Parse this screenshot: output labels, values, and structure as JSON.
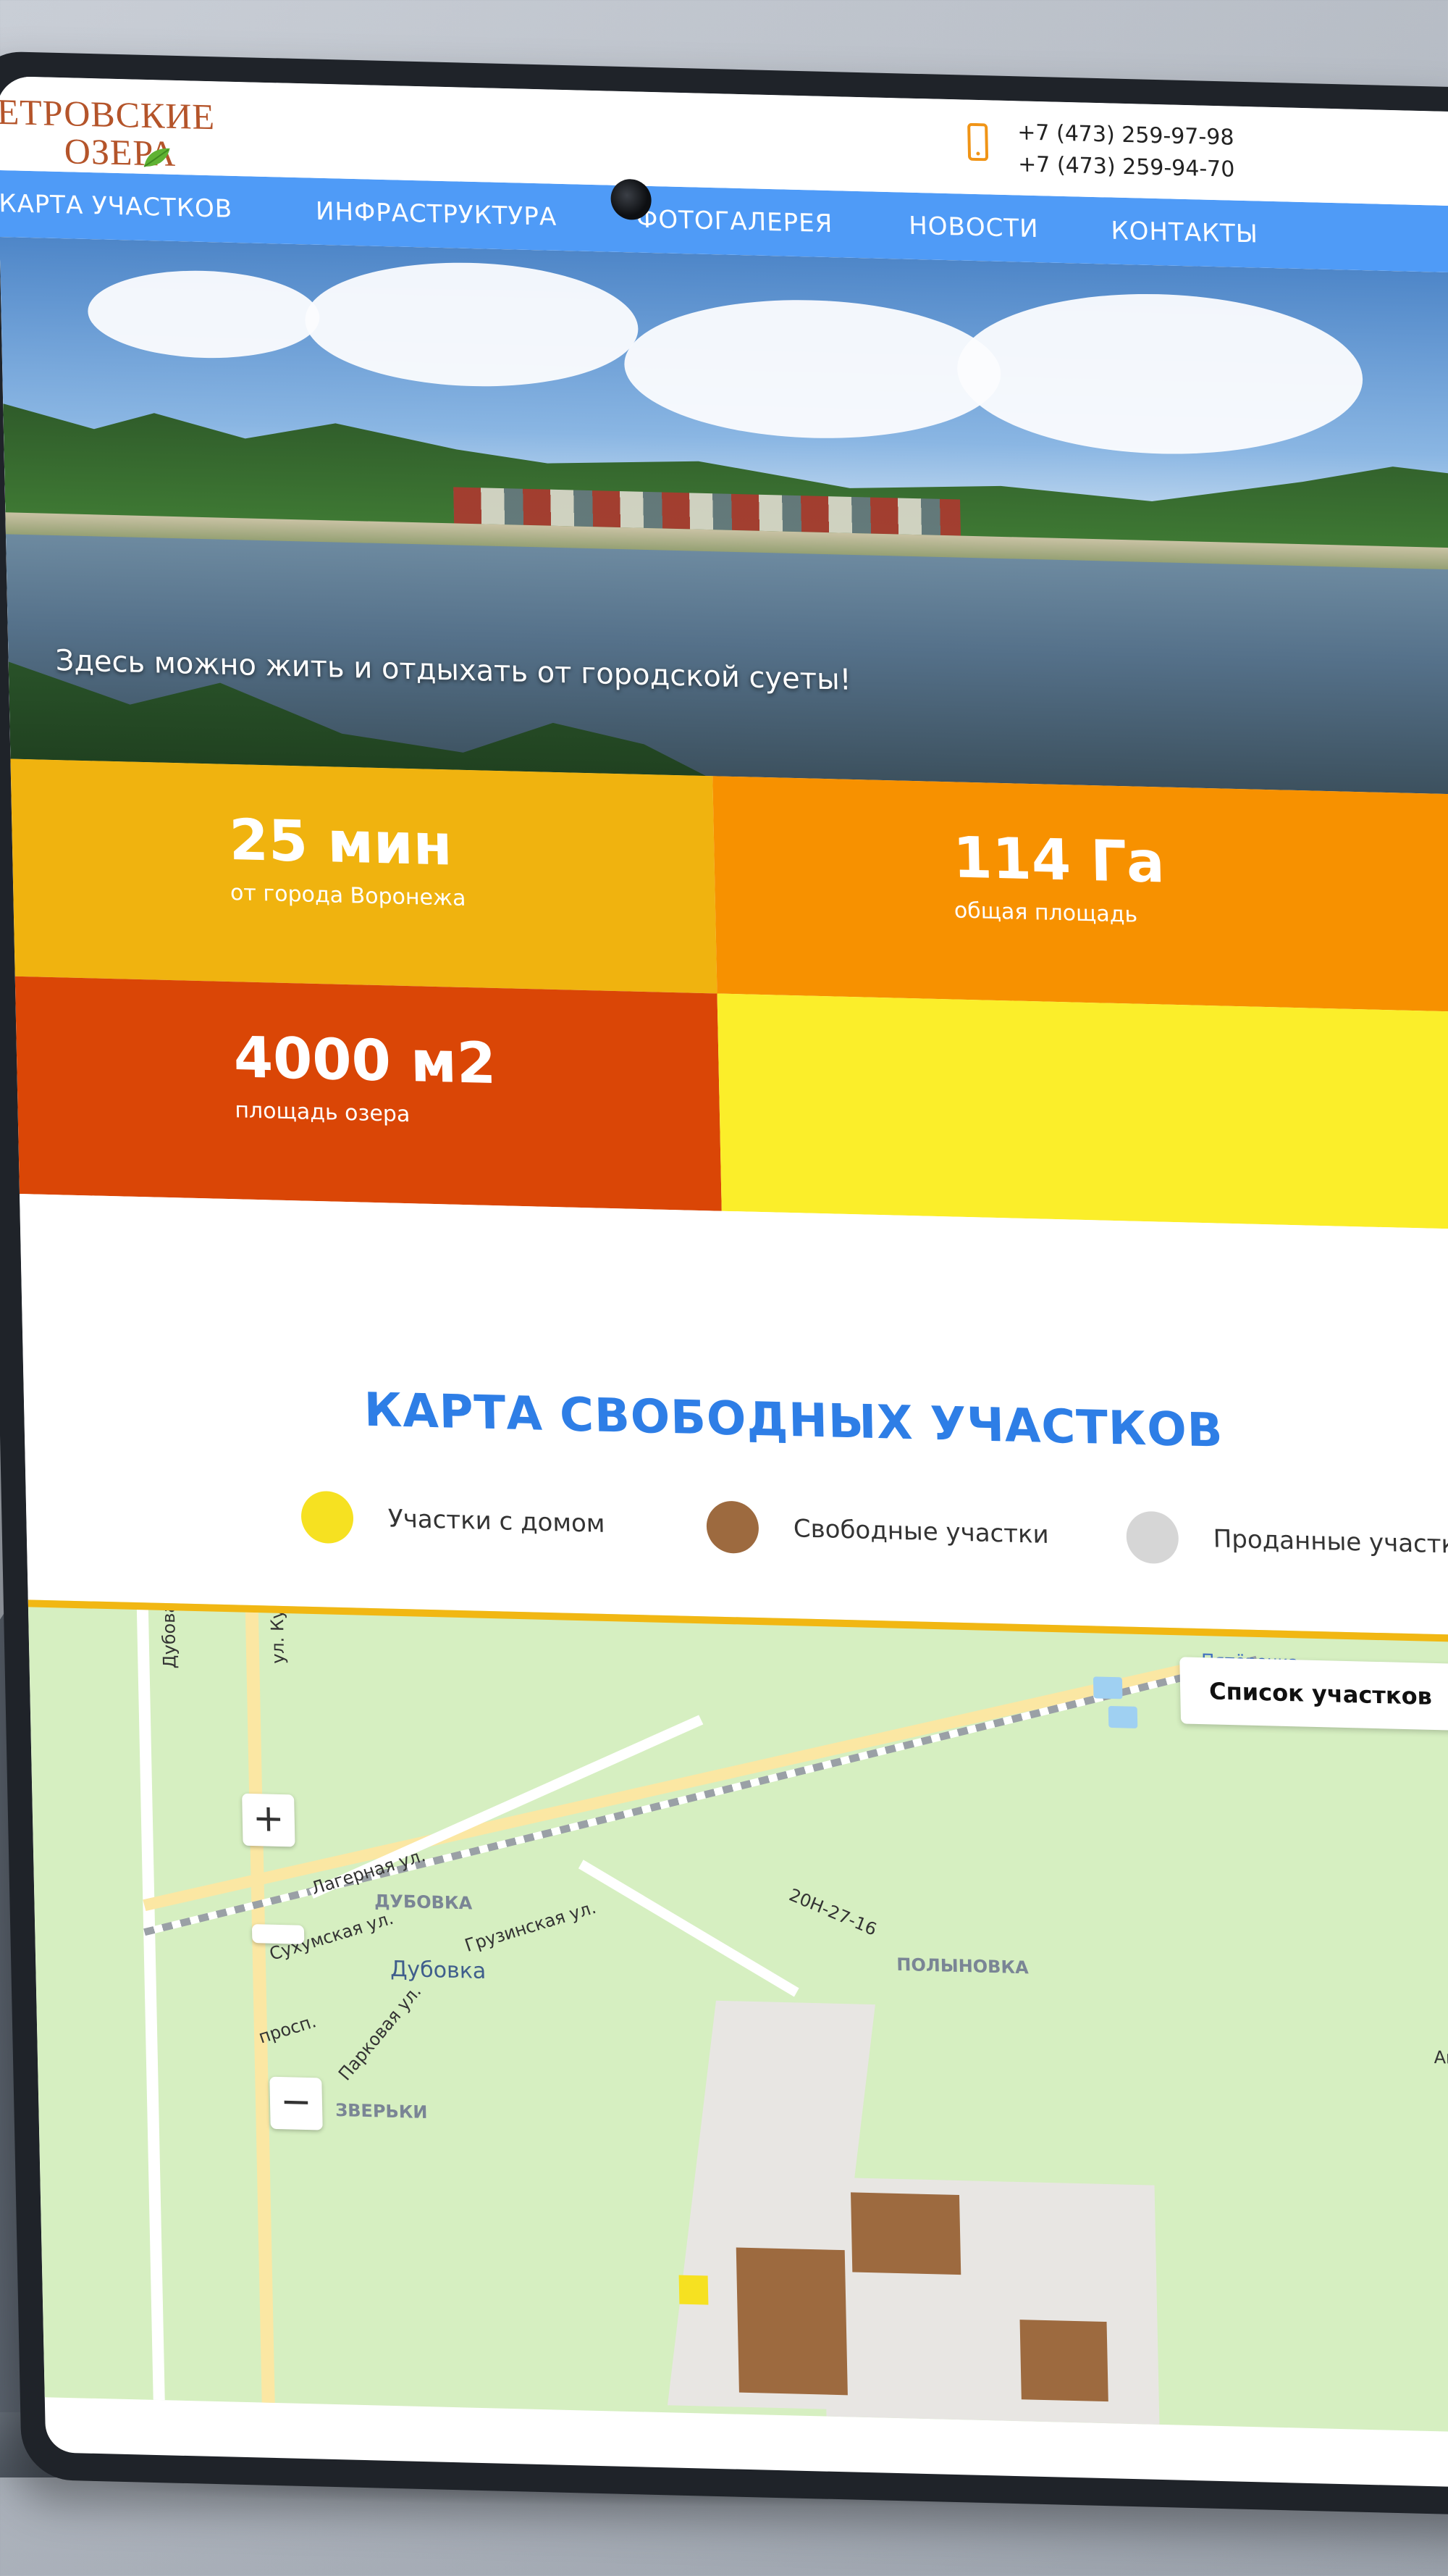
{
  "header": {
    "logo_line1": "ЕТРОВСКИЕ",
    "logo_line2": "ОЗЕРА",
    "phone1": "+7 (473) 259-97-98",
    "phone2": "+7 (473) 259-94-70"
  },
  "nav": {
    "items": [
      "КАРТА УЧАСТКОВ",
      "ИНФРАСТРУКТУРА",
      "ФОТОГАЛЕРЕЯ",
      "НОВОСТИ",
      "КОНТАКТЫ"
    ]
  },
  "hero": {
    "caption": "Здесь можно жить и отдыхать от городской суеты!"
  },
  "stats": [
    {
      "value": "25 мин",
      "label": "от города Воронежа",
      "color": "#f0b30f"
    },
    {
      "value": "114 Га",
      "label": "общая площадь",
      "color": "#f79100"
    },
    {
      "value": "4000 м2",
      "label": "площадь озера",
      "color": "#da4606"
    },
    {
      "value": "",
      "label": "",
      "color": "#fbee2a"
    }
  ],
  "map_section": {
    "title": "КАРТА СВОБОДНЫХ УЧАСТКОВ",
    "legend": [
      {
        "label": "Участки с домом",
        "color": "#f6e121"
      },
      {
        "label": "Свободные участки",
        "color": "#9d6a3f"
      },
      {
        "label": "Проданные участк",
        "color": "#d6d6d6"
      }
    ],
    "plots_list_button": "Список участков"
  },
  "map": {
    "labels": {
      "dubovaya": "Дубовая ул.",
      "kurnatovskogo": "ул. Курнато",
      "lagernaya": "Лагерная ул.",
      "dubovka_area": "ДУБОВКА",
      "gruzinskaya": "Грузинская ул.",
      "sukhumskaya": "Сухумская ул.",
      "dubovka_stop": "Дубовка",
      "road_code": "20Н-27-16",
      "polynovka": "ПОЛЫНОВКА",
      "prosp": "просп.",
      "parkovaya": "Парковая ул.",
      "zverki": "ЗВЕРЬКИ",
      "pyaterochka": "Пятёрочка",
      "aposto": "Апосто"
    },
    "zoom_in": "+",
    "zoom_out": "−"
  }
}
